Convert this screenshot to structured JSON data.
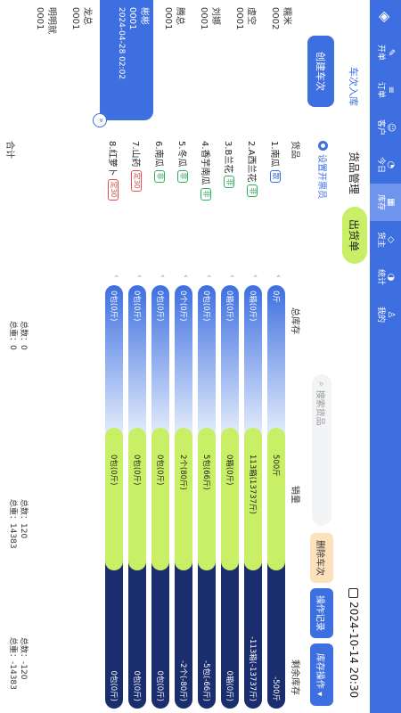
{
  "nav": {
    "items": [
      {
        "icon": "order-icon",
        "label": "开单"
      },
      {
        "icon": "order-list-icon",
        "label": "订单"
      },
      {
        "icon": "customer-icon",
        "label": "客户"
      },
      {
        "icon": "today-icon",
        "label": "今日"
      },
      {
        "icon": "inventory-icon",
        "label": "库存"
      },
      {
        "icon": "owner-icon",
        "label": "货主"
      },
      {
        "icon": "stats-icon",
        "label": "统计"
      },
      {
        "icon": "mine-icon",
        "label": "我的"
      }
    ],
    "active_index": 4
  },
  "left": {
    "title": "车次入库",
    "create_button": "创建车次",
    "batches": [
      {
        "name": "糯米",
        "code": "0002"
      },
      {
        "name": "虚空",
        "code": "0001"
      },
      {
        "name": "刘娜",
        "code": "0001"
      },
      {
        "name": "腾总",
        "code": "0001"
      },
      {
        "name": "彬彬",
        "code": "0001",
        "date": "2024-04-28 02:02",
        "selected": true
      },
      {
        "name": "龙总",
        "code": "0001"
      },
      {
        "name": "明明就",
        "code": "0001"
      }
    ],
    "chevron": "»"
  },
  "tabs": {
    "manage": "货品管理",
    "out": "出货单"
  },
  "settings_link": "设置开票员",
  "search": {
    "placeholder": "搜索货品"
  },
  "buttons": {
    "delete_batch": "删除车次",
    "op_record": "操作记录",
    "stock_op": "库存操作 ▾"
  },
  "clock": "2024-10-14 20:30",
  "columns": {
    "product": "货品",
    "stock": "总库存",
    "sales": "销量",
    "remain": "剩余库存"
  },
  "products": [
    {
      "name": "1.南瓜",
      "tag": "散",
      "tag_type": "w",
      "stock": "0斤",
      "sales": "500斤",
      "remain": "-500斤"
    },
    {
      "name": "2.A西兰花",
      "tag": "非",
      "tag_type": "g",
      "stock": "0箱(0斤)",
      "sales": "113箱(13737斤)",
      "remain": "-113箱(-13737斤)"
    },
    {
      "name": "3.B兰花",
      "tag": "非",
      "tag_type": "g",
      "stock": "0箱(0斤)",
      "sales": "0箱(0斤)",
      "remain": "0箱(0斤)"
    },
    {
      "name": "4.香芋南瓜",
      "tag": "非",
      "tag_type": "g",
      "stock": "0包(0斤)",
      "sales": "5包(66斤)",
      "remain": "-5包(-66斤)"
    },
    {
      "name": "5.冬瓜",
      "tag": "非",
      "tag_type": "g",
      "stock": "0个(0斤)",
      "sales": "2个(80斤)",
      "remain": "-2个(-80斤)"
    },
    {
      "name": "6.南瓜",
      "tag": "非",
      "tag_type": "g",
      "stock": "0包(0斤)",
      "sales": "0包(0斤)",
      "remain": "0包(0斤)"
    },
    {
      "name": "7.山药",
      "tag": "定30",
      "tag_type": "r",
      "stock": "0包(0斤)",
      "sales": "0包(0斤)",
      "remain": "0包(0斤)"
    },
    {
      "name": "8.红萝卜",
      "tag": "定30",
      "tag_type": "r",
      "stock": "0包(0斤)",
      "sales": "0包(0斤)",
      "remain": "0包(0斤)"
    }
  ],
  "totals": {
    "label": "合计",
    "stock_count": "总数：0",
    "stock_weight": "总重：0",
    "sales_count": "总数：120",
    "sales_weight": "总重：14383",
    "remain_count": "总数：-120",
    "remain_weight": "总重：-14383"
  },
  "colors": {
    "primary": "#3e6fe0",
    "accent_green": "#c8ef65",
    "dark_navy": "#1a2d6d",
    "delete_orange": "#fde1bd"
  }
}
